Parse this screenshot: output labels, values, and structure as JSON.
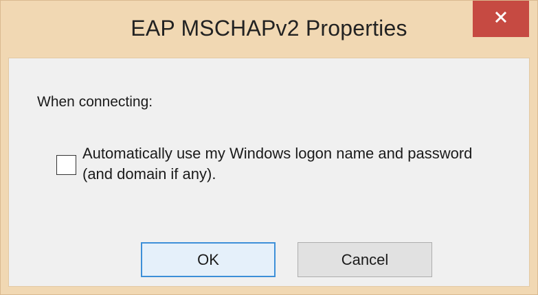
{
  "window": {
    "title": "EAP MSCHAPv2 Properties",
    "close_icon": "close-icon"
  },
  "content": {
    "section_label": "When connecting:",
    "checkbox": {
      "checked": false,
      "label": "Automatically use my Windows logon name and password (and domain if any)."
    }
  },
  "buttons": {
    "ok_label": "OK",
    "cancel_label": "Cancel"
  },
  "colors": {
    "title_bar": "#f1d8b3",
    "close_button": "#c64a42",
    "client_area": "#f0f0f0",
    "default_button_border": "#3c8fd8"
  }
}
